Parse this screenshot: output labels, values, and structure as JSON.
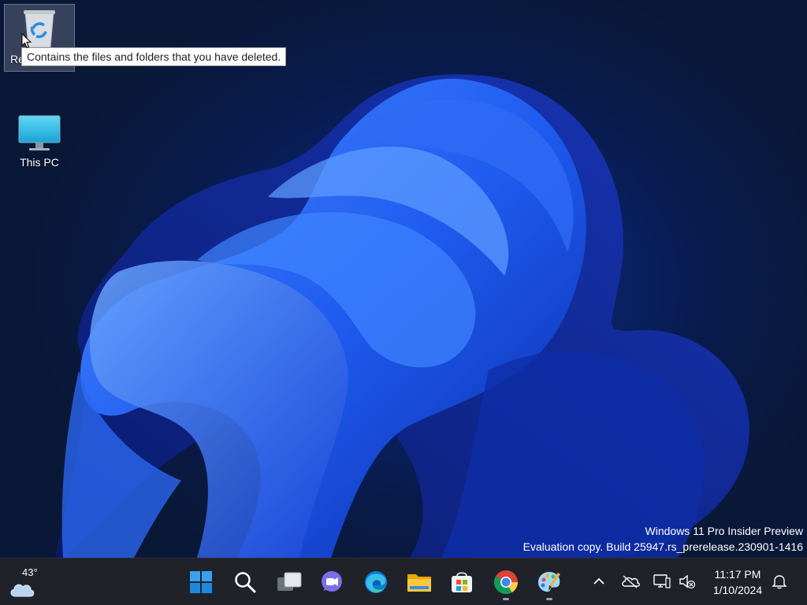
{
  "desktop": {
    "icons": [
      {
        "label": "Recycle Bin",
        "icon": "recycle-bin-icon"
      },
      {
        "label": "This PC",
        "icon": "monitor-icon"
      }
    ],
    "tooltip": "Contains the files and folders that you have deleted.",
    "watermark": {
      "line1": "Windows 11 Pro Insider Preview",
      "line2": "Evaluation copy. Build 25947.rs_prerelease.230901-1416"
    }
  },
  "taskbar": {
    "weather": {
      "temp": "43°",
      "icon": "cloud-icon"
    },
    "apps": [
      {
        "name": "Start",
        "icon": "windows-start-icon"
      },
      {
        "name": "Search",
        "icon": "search-icon"
      },
      {
        "name": "Task View",
        "icon": "task-view-icon"
      },
      {
        "name": "Chat",
        "icon": "chat-icon"
      },
      {
        "name": "Microsoft Edge",
        "icon": "edge-icon"
      },
      {
        "name": "File Explorer",
        "icon": "file-explorer-icon"
      },
      {
        "name": "Microsoft Store",
        "icon": "store-icon"
      },
      {
        "name": "Google Chrome",
        "icon": "chrome-icon",
        "running": true
      },
      {
        "name": "Paint",
        "icon": "paint-icon",
        "running": true
      }
    ],
    "tray": {
      "icons": [
        "chevron-up-icon",
        "onedrive-icon",
        "network-icon",
        "volume-muted-icon"
      ],
      "time": "11:17 PM",
      "date": "1/10/2024",
      "notification_icon": "bell-icon"
    }
  },
  "colors": {
    "taskbar": "#1f2229",
    "accent": "#0067c0",
    "wallpaper": "#1a4fd6"
  }
}
